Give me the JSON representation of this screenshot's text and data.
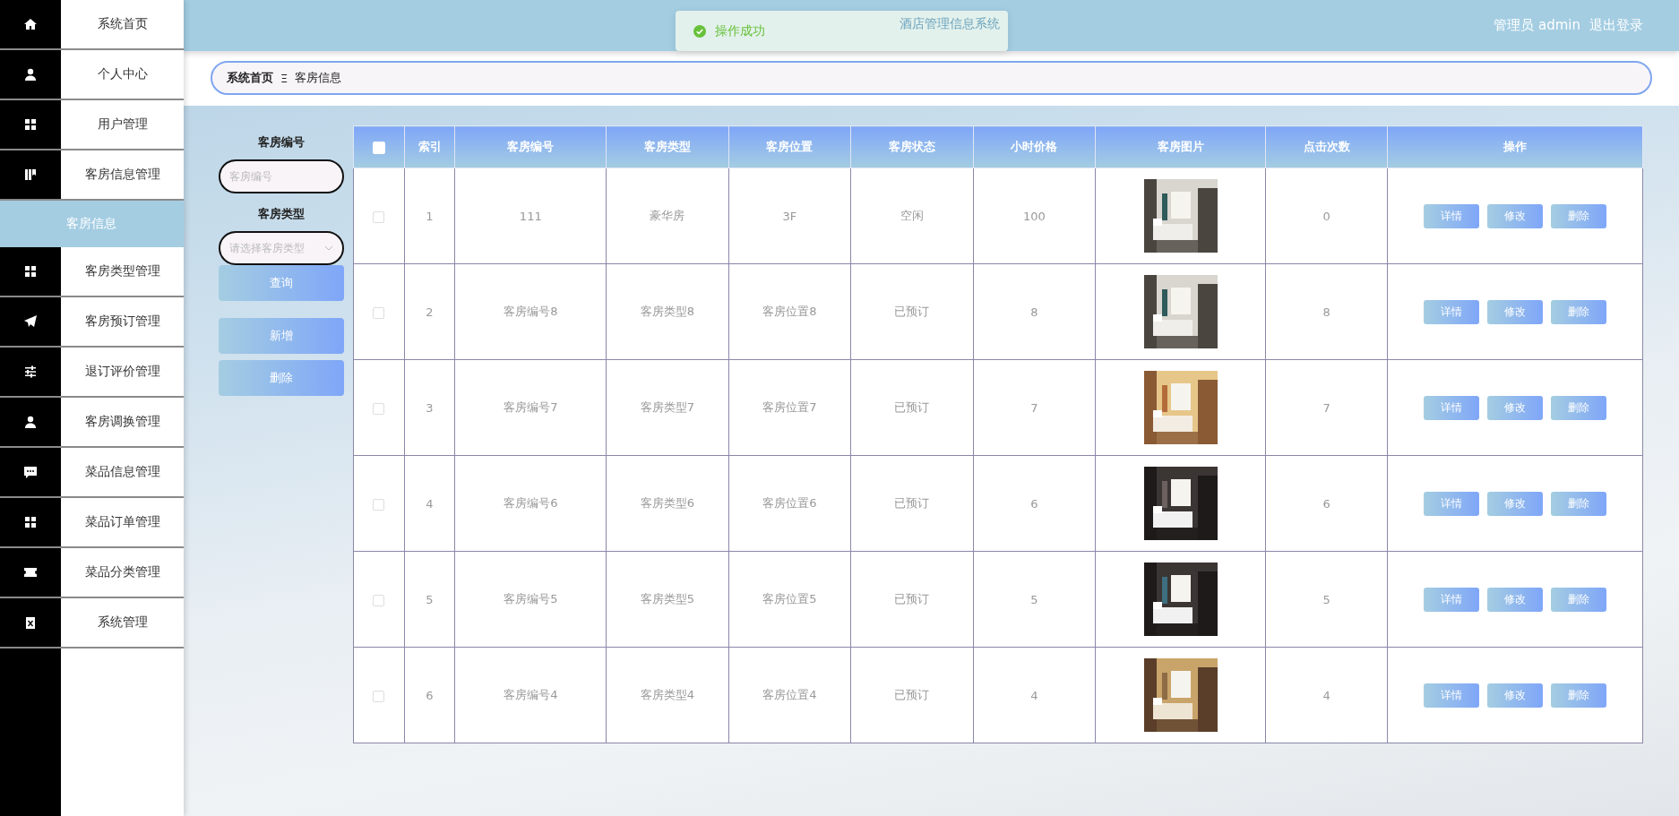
{
  "sidebar": {
    "items": [
      {
        "label": "系统首页",
        "selected": false
      },
      {
        "label": "个人中心",
        "selected": false
      },
      {
        "label": "用户管理",
        "selected": false
      },
      {
        "label": "客房信息管理",
        "selected": false,
        "children": [
          {
            "label": "客房信息",
            "selected": true
          }
        ]
      },
      {
        "label": "客房类型管理",
        "selected": false
      },
      {
        "label": "客房预订管理",
        "selected": false
      },
      {
        "label": "退订评价管理",
        "selected": false
      },
      {
        "label": "客房调换管理",
        "selected": false
      },
      {
        "label": "菜品信息管理",
        "selected": false
      },
      {
        "label": "菜品订单管理",
        "selected": false
      },
      {
        "label": "菜品分类管理",
        "selected": false
      },
      {
        "label": "系统管理",
        "selected": false
      }
    ]
  },
  "header": {
    "title": "酒店管理信息系统",
    "user": "管理员 admin",
    "logout": "退出登录"
  },
  "toast": {
    "message": "操作成功"
  },
  "breadcrumb": {
    "items": [
      "系统首页",
      "客房信息"
    ],
    "separator": "Ξ"
  },
  "search": {
    "fields": [
      {
        "label": "客房编号",
        "kind": "input",
        "placeholder": "客房编号"
      },
      {
        "label": "客房类型",
        "kind": "select",
        "placeholder": "请选择客房类型"
      }
    ],
    "query_button": "查询",
    "buttons": [
      "新增",
      "删除"
    ]
  },
  "table": {
    "header_checked": false,
    "columns": [
      "索引",
      "客房编号",
      "客房类型",
      "客房位置",
      "客房状态",
      "小时价格",
      "客房图片",
      "点击次数",
      "操作"
    ],
    "rows": [
      {
        "checked": false,
        "cells": [
          "1",
          "111",
          "豪华房",
          "3F",
          "空闲",
          "100"
        ],
        "clicks": "0",
        "actions": [
          "详情",
          "修改",
          "删除"
        ]
      },
      {
        "checked": false,
        "cells": [
          "2",
          "客房编号8",
          "客房类型8",
          "客房位置8",
          "已预订",
          "8"
        ],
        "clicks": "8",
        "actions": [
          "详情",
          "修改",
          "删除"
        ]
      },
      {
        "checked": false,
        "cells": [
          "3",
          "客房编号7",
          "客房类型7",
          "客房位置7",
          "已预订",
          "7"
        ],
        "clicks": "7",
        "actions": [
          "详情",
          "修改",
          "删除"
        ]
      },
      {
        "checked": false,
        "cells": [
          "4",
          "客房编号6",
          "客房类型6",
          "客房位置6",
          "已预订",
          "6"
        ],
        "clicks": "6",
        "actions": [
          "详情",
          "修改",
          "删除"
        ]
      },
      {
        "checked": false,
        "cells": [
          "5",
          "客房编号5",
          "客房类型5",
          "客房位置5",
          "已预订",
          "5"
        ],
        "clicks": "5",
        "actions": [
          "详情",
          "修改",
          "删除"
        ]
      },
      {
        "checked": false,
        "cells": [
          "6",
          "客房编号4",
          "客房类型4",
          "客房位置4",
          "已预订",
          "4"
        ],
        "clicks": "4",
        "actions": [
          "详情",
          "修改",
          "删除"
        ]
      }
    ]
  }
}
